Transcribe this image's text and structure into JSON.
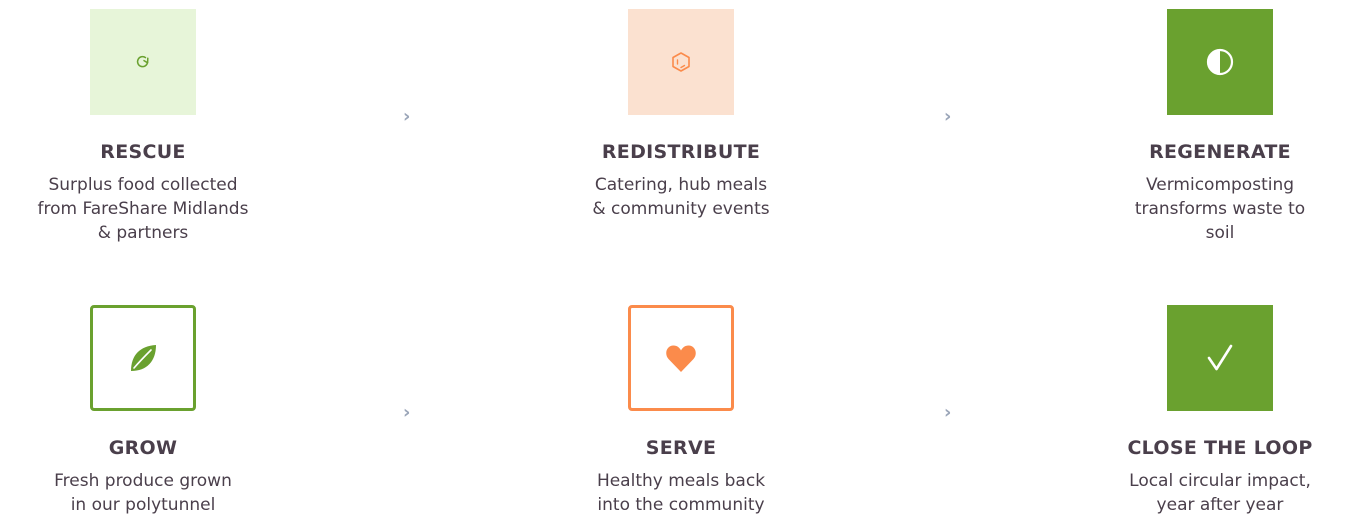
{
  "colors": {
    "green": "#6aa12f",
    "light_green": "#e7f5d9",
    "orange": "#fb8b4b",
    "light_orange": "#fbe1d0",
    "text": "#4a3f4b",
    "arrow": "#9aa5b8"
  },
  "arrow_glyph": "›",
  "steps": [
    {
      "title": "RESCUE",
      "desc_lines": [
        "Surplus food collected",
        "from FareShare Midlands",
        "& partners"
      ],
      "icon": "refresh-icon"
    },
    {
      "title": "REDISTRIBUTE",
      "desc_lines": [
        "Catering, hub meals",
        "& community events"
      ],
      "icon": "hexagon-icon"
    },
    {
      "title": "REGENERATE",
      "desc_lines": [
        "Vermicomposting",
        "transforms waste to",
        "soil"
      ],
      "icon": "half-circle-icon"
    },
    {
      "title": "GROW",
      "desc_lines": [
        "Fresh produce grown",
        "in our polytunnel"
      ],
      "icon": "leaf-icon"
    },
    {
      "title": "SERVE",
      "desc_lines": [
        "Healthy meals back",
        "into the community"
      ],
      "icon": "heart-icon"
    },
    {
      "title": "CLOSE THE LOOP",
      "desc_lines": [
        "Local circular impact,",
        "year after year"
      ],
      "icon": "checkmark-icon"
    }
  ]
}
